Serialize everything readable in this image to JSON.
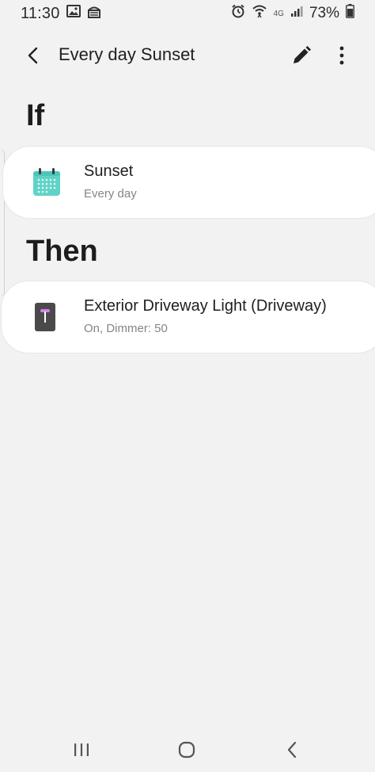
{
  "status_bar": {
    "time": "11:30",
    "battery": "73%",
    "network": "4G"
  },
  "app_bar": {
    "title": "Every day Sunset"
  },
  "sections": {
    "if_heading": "If",
    "then_heading": "Then"
  },
  "condition": {
    "title": "Sunset",
    "subtitle": "Every day"
  },
  "action": {
    "title": "Exterior Driveway Light (Driveway)",
    "subtitle": "On, Dimmer: 50"
  },
  "colors": {
    "calendar_icon": "#5fd3c7",
    "device_icon": "#4a4a4a",
    "device_accent": "#d27ff0"
  },
  "icons": {
    "back": "arrow-left-icon",
    "edit": "pencil-icon",
    "more": "more-vertical-icon",
    "condition": "calendar-icon",
    "action": "light-switch-icon"
  }
}
